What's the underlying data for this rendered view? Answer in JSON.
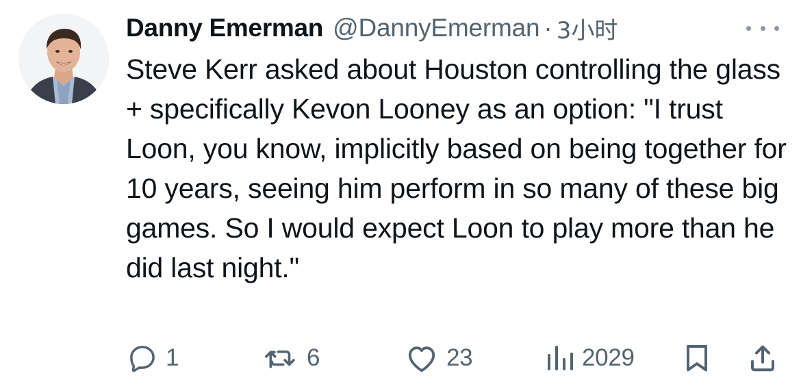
{
  "tweet": {
    "author": {
      "display_name": "Danny Emerman",
      "handle": "@DannyEmerman",
      "avatar_icon": "profile-photo"
    },
    "separator": "·",
    "time": "3小时",
    "more_icon": "more-horizontal-icon",
    "text": "Steve Kerr asked about Houston controlling the glass + specifically Kevon Looney as an option: \"I trust Loon, you know, implicitly based on being together for 10 years, seeing him perform in so many of these big games. So I would expect Loon to play more than he did last night.\""
  },
  "actions": {
    "replies": "1",
    "retweets": "6",
    "likes": "23",
    "views": "2029"
  },
  "colors": {
    "text": "#0f1419",
    "secondary": "#536471",
    "icon": "#536471"
  }
}
